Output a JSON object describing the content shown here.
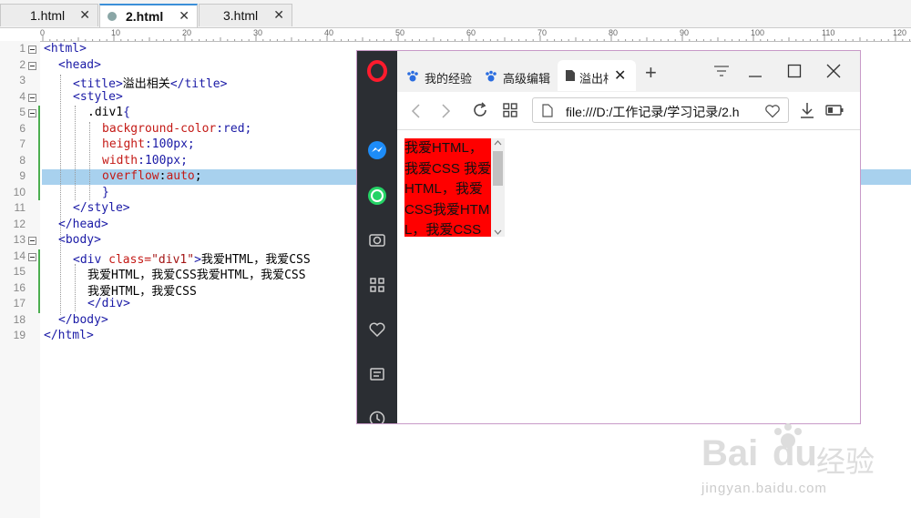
{
  "editor": {
    "tabs": [
      {
        "label": "1.html",
        "active": false
      },
      {
        "label": "2.html",
        "active": true
      },
      {
        "label": "3.html",
        "active": false
      }
    ],
    "ruler_marks": [
      "0",
      "10",
      "20",
      "30",
      "40",
      "50",
      "60",
      "70",
      "80",
      "90",
      "100",
      "110",
      "120"
    ],
    "line_numbers": [
      "1",
      "2",
      "3",
      "4",
      "5",
      "6",
      "7",
      "8",
      "9",
      "10",
      "11",
      "12",
      "13",
      "14",
      "15",
      "16",
      "17",
      "18",
      "19"
    ],
    "lines": [
      {
        "parts": [
          {
            "t": "<html>",
            "c": "tag"
          }
        ]
      },
      {
        "parts": [
          {
            "t": "<head>",
            "c": "tag"
          }
        ]
      },
      {
        "parts": [
          {
            "t": "<title>",
            "c": "tag"
          },
          {
            "t": "溢出相关",
            "c": ""
          },
          {
            "t": "</title>",
            "c": "tag"
          }
        ]
      },
      {
        "parts": [
          {
            "t": "<style>",
            "c": "tag"
          }
        ]
      },
      {
        "parts": [
          {
            "t": ".div1",
            "c": ""
          },
          {
            "t": "{",
            "c": "tag"
          }
        ]
      },
      {
        "parts": [
          {
            "t": "background-color",
            "c": "prop"
          },
          {
            "t": ":red;",
            "c": "pval"
          }
        ]
      },
      {
        "parts": [
          {
            "t": "height",
            "c": "prop"
          },
          {
            "t": ":100px;",
            "c": "pval"
          }
        ]
      },
      {
        "parts": [
          {
            "t": "width",
            "c": "prop"
          },
          {
            "t": ":100px;",
            "c": "pval"
          }
        ]
      },
      {
        "parts": [
          {
            "t": "overflow",
            "c": "prop"
          },
          {
            "t": ":",
            "c": ""
          },
          {
            "t": "auto",
            "c": "prop"
          },
          {
            "t": ";",
            "c": ""
          }
        ]
      },
      {
        "parts": [
          {
            "t": "}",
            "c": "tag"
          }
        ]
      },
      {
        "parts": [
          {
            "t": "</style>",
            "c": "tag"
          }
        ]
      },
      {
        "parts": [
          {
            "t": "</head>",
            "c": "tag"
          }
        ]
      },
      {
        "parts": [
          {
            "t": "<body>",
            "c": "tag"
          }
        ]
      },
      {
        "parts": [
          {
            "t": "<div ",
            "c": "tag"
          },
          {
            "t": "class=",
            "c": "attr"
          },
          {
            "t": "\"div1\"",
            "c": "val"
          },
          {
            "t": ">",
            "c": "tag"
          },
          {
            "t": "我爱HTML，我爱CSS",
            "c": ""
          }
        ]
      },
      {
        "parts": [
          {
            "t": "我爱HTML，我爱CSS我爱HTML，我爱CSS",
            "c": ""
          }
        ]
      },
      {
        "parts": [
          {
            "t": "我爱HTML，我爱CSS",
            "c": ""
          }
        ]
      },
      {
        "parts": [
          {
            "t": "</div>",
            "c": "tag"
          }
        ]
      },
      {
        "parts": [
          {
            "t": "</body>",
            "c": "tag"
          }
        ]
      },
      {
        "parts": [
          {
            "t": "</html>",
            "c": "tag"
          }
        ]
      }
    ]
  },
  "browser": {
    "tabs": [
      {
        "label": "我的经验",
        "icon": "paw-icon"
      },
      {
        "label": "高级编辑",
        "icon": "paw-icon"
      },
      {
        "label": "溢出相",
        "icon": "page-icon",
        "active": true
      }
    ],
    "address": "file:///D:/工作记录/学习记录/2.h",
    "div_text": "我爱HTML，我爱CSS 我爱HTML，我爱CSS我爱HTML，我爱CSS 我爱HTML，我爱CSS",
    "div_color": "#ff0000",
    "scroll_position": 0.0
  },
  "watermark": {
    "brand": "Bai",
    "brand2": "du",
    "cn": "经验",
    "url": "jingyan.baidu.com"
  }
}
